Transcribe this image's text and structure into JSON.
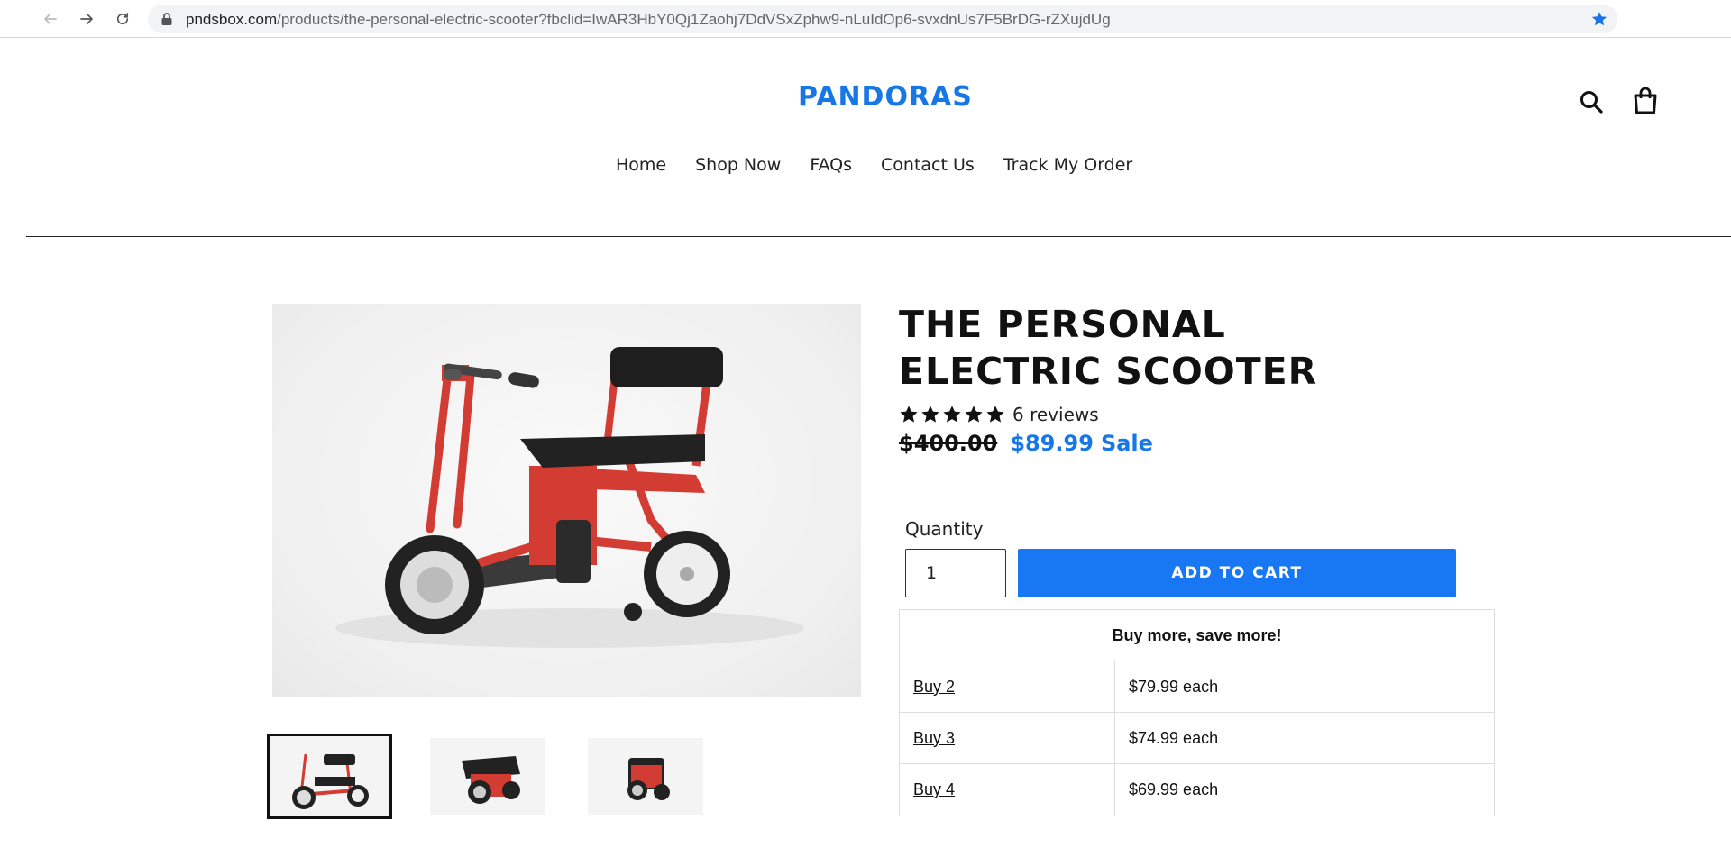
{
  "browser": {
    "url_host": "pndsbox.com",
    "url_path": "/products/the-personal-electric-scooter?fbclid=IwAR3HbY0Qj1Zaohj7DdVSxZphw9-nLuIdOp6-svxdnUs7F5BrDG-rZXujdUg",
    "bookmark_color": "#1a73e8"
  },
  "header": {
    "logo": "PANDORAS",
    "brand_color": "#1877e6",
    "icons": [
      "search-icon",
      "cart-icon"
    ]
  },
  "nav": {
    "items": [
      "Home",
      "Shop Now",
      "FAQs",
      "Contact Us",
      "Track My Order"
    ]
  },
  "product": {
    "title": "THE PERSONAL ELECTRIC SCOOTER",
    "rating": 5,
    "reviews": "6 reviews",
    "regular_price": "$400.00",
    "sale_price": "$89.99",
    "sale_label": "Sale",
    "quantity_label": "Quantity",
    "quantity_value": "1",
    "add_to_cart": "ADD TO CART",
    "thumbnails": [
      "thumbnail-1",
      "thumbnail-2",
      "thumbnail-3"
    ],
    "active_thumbnail": 0
  },
  "bundle": {
    "heading": "Buy more, save more!",
    "rows": [
      {
        "qty": "Buy 2",
        "price": "$79.99 each"
      },
      {
        "qty": "Buy 3",
        "price": "$74.99 each"
      },
      {
        "qty": "Buy 4",
        "price": "$69.99 each"
      }
    ]
  }
}
